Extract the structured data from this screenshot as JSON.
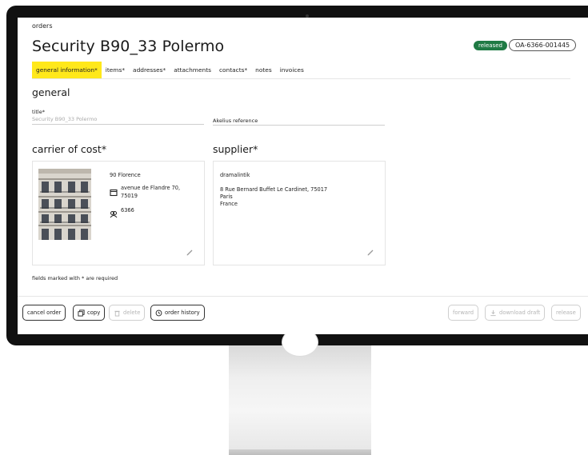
{
  "breadcrumb": "orders",
  "title": "Security B90_33 Polermo",
  "status_badge": "released",
  "order_id": "OA-6366-001445",
  "tabs": [
    {
      "label": "general information*",
      "active": true
    },
    {
      "label": "items*"
    },
    {
      "label": "addresses*"
    },
    {
      "label": "attachments"
    },
    {
      "label": "contacts*"
    },
    {
      "label": "notes"
    },
    {
      "label": "invoices"
    }
  ],
  "general": {
    "heading": "general",
    "title_label": "title*",
    "title_value": "Security B90_33 Polermo",
    "akelius_label": "Akelius reference"
  },
  "carrier": {
    "heading": "carrier of cost*",
    "name": "90 Florence",
    "address_line1": "avenue de Flandre 70,",
    "address_line2": "75019",
    "code": "6366"
  },
  "supplier": {
    "heading": "supplier*",
    "name": "dramalintik",
    "address": "8 Rue Bernard Buffet Le Cardinet, 75017",
    "city": "Paris",
    "country": "France"
  },
  "required_note": "fields marked with * are required",
  "footer": {
    "cancel": "cancel order",
    "copy": "copy",
    "delete": "delete",
    "history": "order history",
    "forward": "forward",
    "download": "download draft",
    "release": "release"
  },
  "colors": {
    "active_tab": "#ffe81a",
    "released_badge": "#1f7a44"
  }
}
